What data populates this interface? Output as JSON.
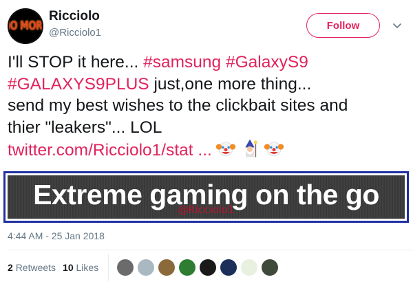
{
  "user": {
    "avatar_text": "NO MORE",
    "display_name": "Ricciolo",
    "handle": "@Ricciolo1"
  },
  "header": {
    "follow_label": "Follow"
  },
  "tweet": {
    "line1_prefix": "I'll STOP it here... ",
    "hashtag_samsung": "#samsung",
    "hashtag_galaxys9": "#GalaxyS9",
    "hashtag_galaxys9plus": "#GALAXYS9PLUS",
    "line2_suffix": " just,one more thing...",
    "line3": "send my best wishes to the clickbait sites and",
    "line4": "thier \"leakers\"... LOL",
    "link": "twitter.com/Ricciolo1/stat ...",
    "emojis": [
      "clown-face-icon",
      "mage-icon",
      "clown-face-icon"
    ]
  },
  "media": {
    "caption": "Extreme gaming on the go",
    "watermark": "@Ricciolo1"
  },
  "meta": {
    "timestamp": "4:44 AM - 25 Jan 2018"
  },
  "stats": {
    "retweets_count": "2",
    "retweets_label": "Retweets",
    "likes_count": "10",
    "likes_label": "Likes"
  },
  "likers": [
    {
      "name": "liker-avatar-1",
      "color": "#6b6b6b"
    },
    {
      "name": "liker-avatar-2",
      "color": "#aab8c2"
    },
    {
      "name": "liker-avatar-3",
      "color": "#8a6a3a"
    },
    {
      "name": "liker-avatar-4",
      "color": "#2e7d32"
    },
    {
      "name": "liker-avatar-5",
      "color": "#1a1a1a"
    },
    {
      "name": "liker-avatar-6",
      "color": "#1c2e5a"
    },
    {
      "name": "liker-avatar-7",
      "color": "#e8f0e0"
    },
    {
      "name": "liker-avatar-8",
      "color": "#3f4a3a"
    }
  ],
  "colors": {
    "accent": "#e0245e",
    "media_border": "#1f2fa0",
    "secondary_text": "#657786"
  }
}
